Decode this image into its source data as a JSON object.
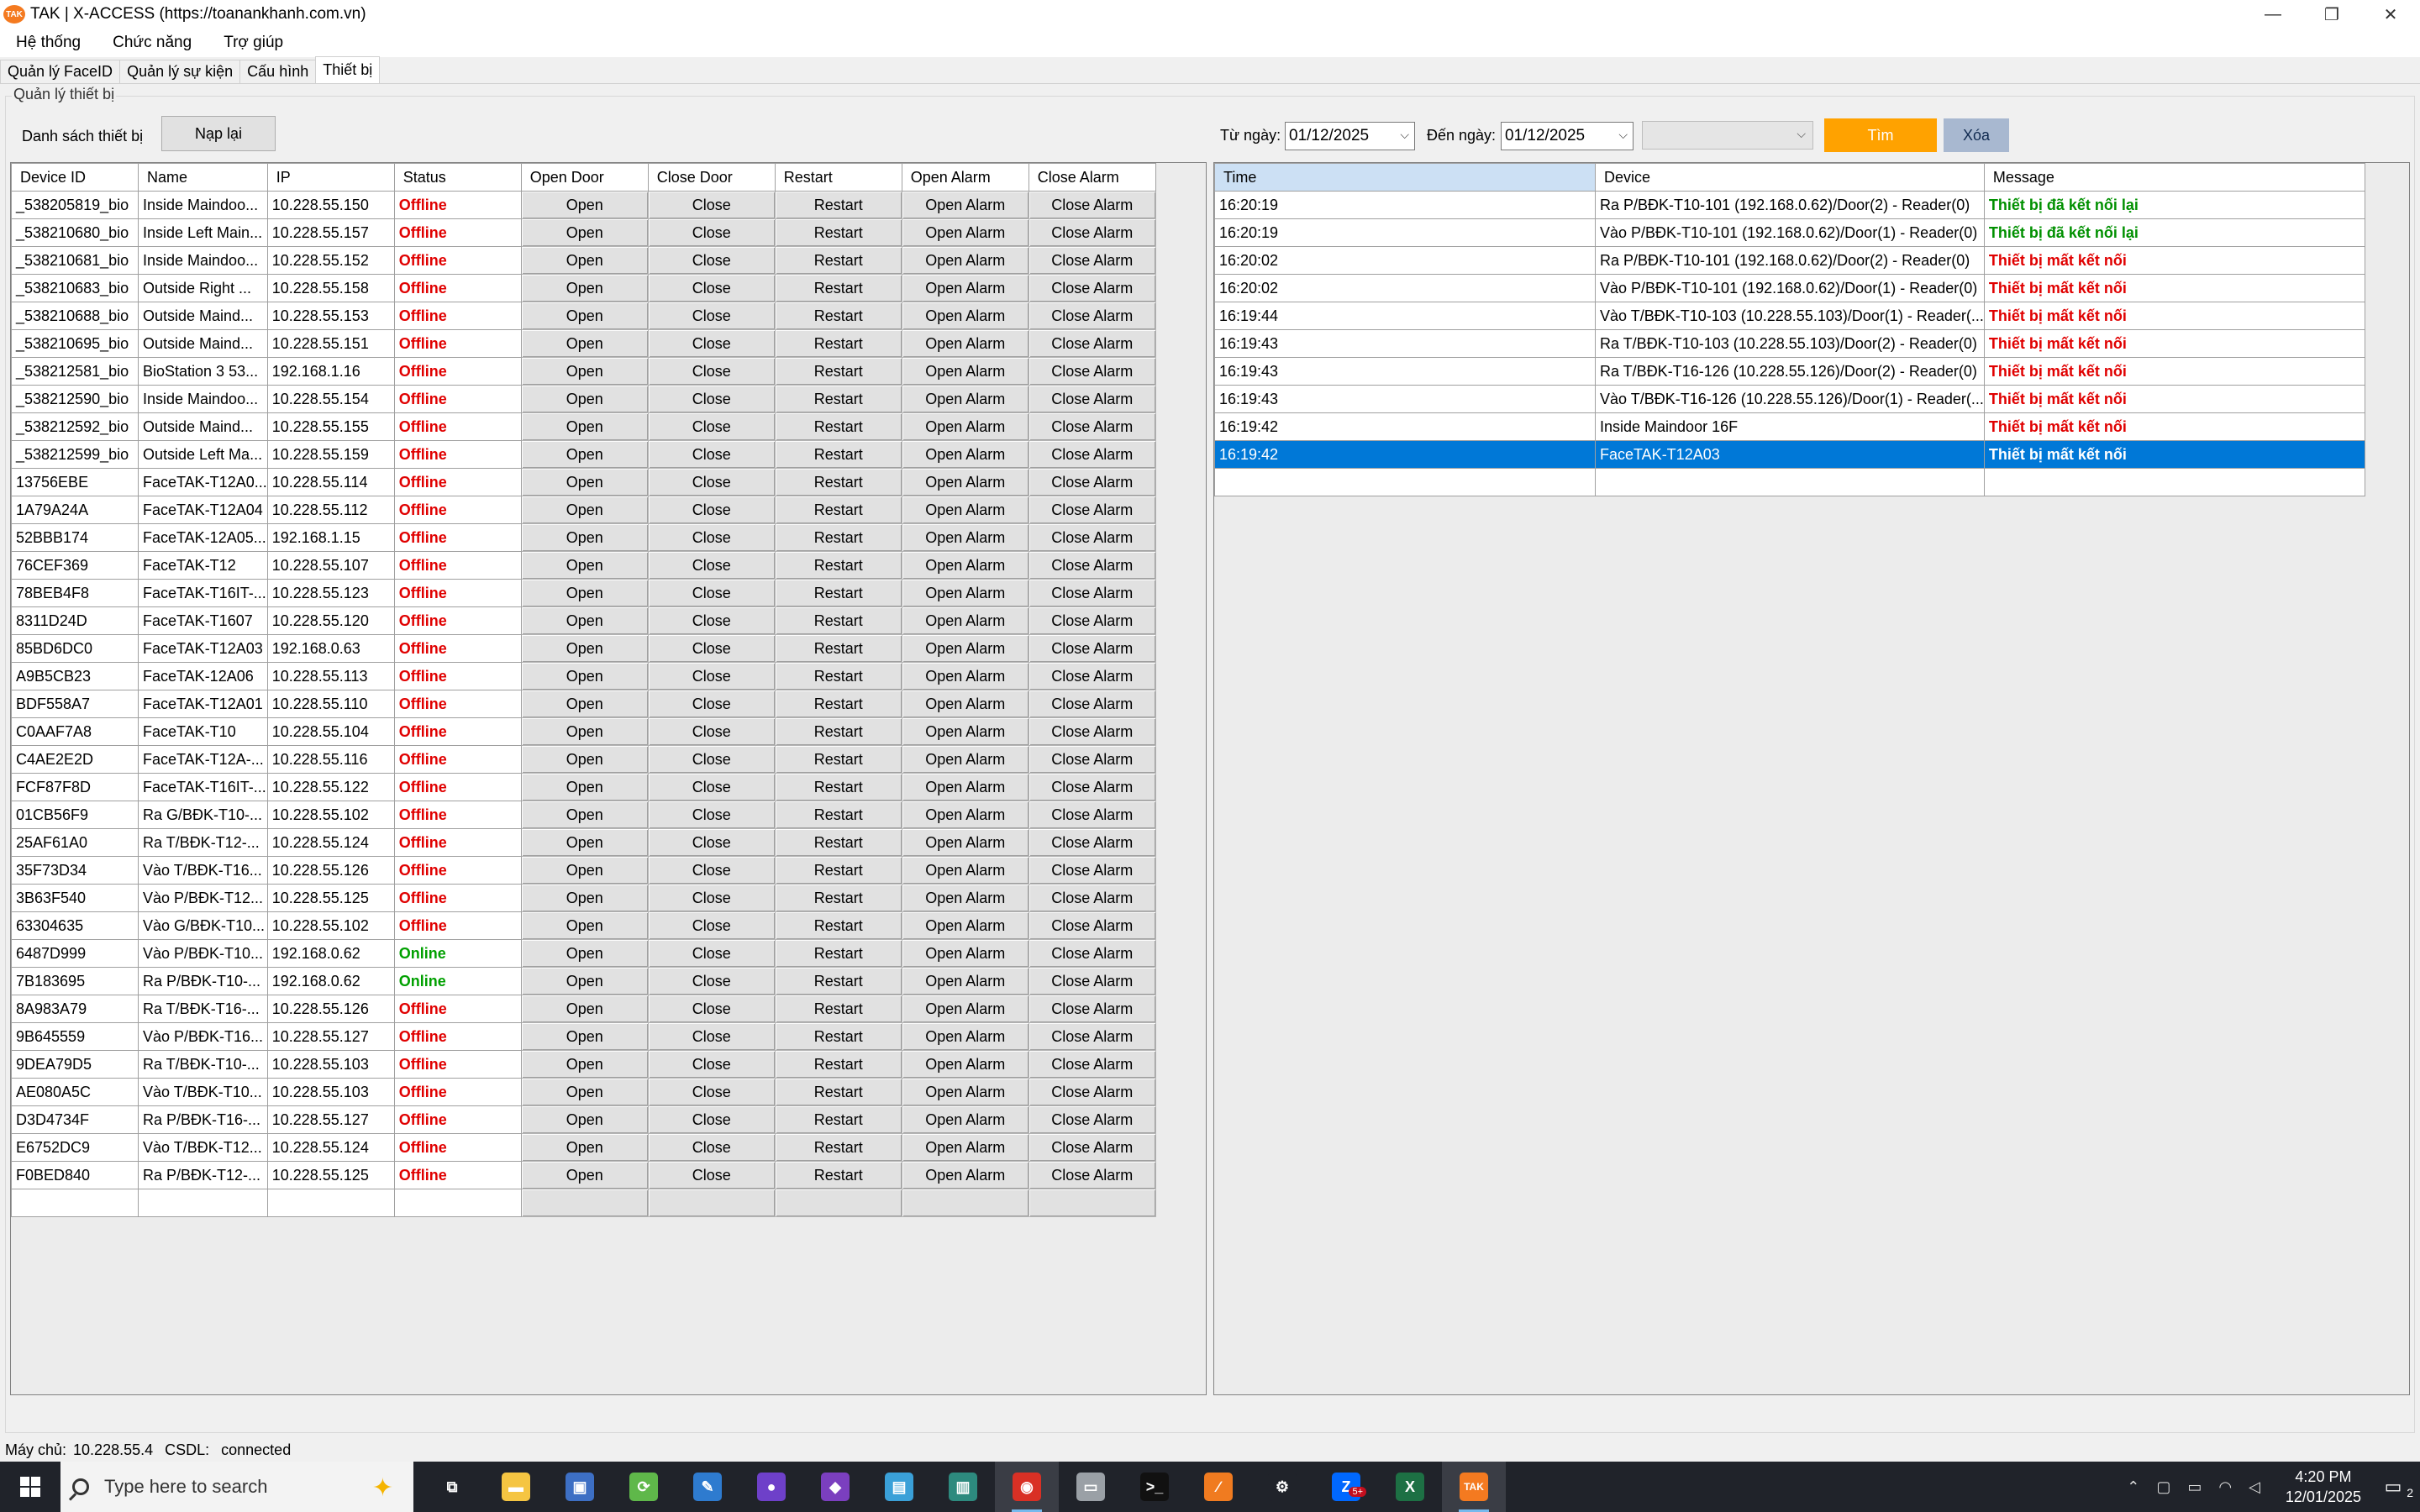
{
  "window": {
    "title": "TAK | X-ACCESS (https://toanankhanh.com.vn)",
    "logo_text": "TAK",
    "minimize": "—",
    "restore": "❐",
    "close": "✕"
  },
  "menu": [
    "Hệ thống",
    "Chức năng",
    "Trợ giúp"
  ],
  "tabs": [
    "Quản lý FaceID",
    "Quản lý sự kiện",
    "Cấu hình",
    "Thiết bị"
  ],
  "group_title": "Quản lý thiết bị",
  "device_list_label": "Danh sách thiết bị",
  "reload_button": "Nạp lại",
  "filter": {
    "from_label": "Từ ngày:",
    "from_value": "01/12/2025",
    "to_label": "Đến ngày:",
    "to_value": "01/12/2025",
    "find_button": "Tìm",
    "clear_button": "Xóa"
  },
  "device_columns": [
    "Device ID",
    "Name",
    "IP",
    "Status",
    "Open Door",
    "Close Door",
    "Restart",
    "Open Alarm",
    "Close Alarm"
  ],
  "device_button_labels": {
    "open": "Open",
    "close": "Close",
    "restart": "Restart",
    "open_alarm": "Open Alarm",
    "close_alarm": "Close Alarm"
  },
  "devices": [
    {
      "id": "_538205819_bio",
      "name": "Inside Maindoo...",
      "ip": "10.228.55.150",
      "status": "Offline"
    },
    {
      "id": "_538210680_bio",
      "name": "Inside Left Main...",
      "ip": "10.228.55.157",
      "status": "Offline"
    },
    {
      "id": "_538210681_bio",
      "name": "Inside Maindoo...",
      "ip": "10.228.55.152",
      "status": "Offline"
    },
    {
      "id": "_538210683_bio",
      "name": "Outside Right ...",
      "ip": "10.228.55.158",
      "status": "Offline"
    },
    {
      "id": "_538210688_bio",
      "name": "Outside Maind...",
      "ip": "10.228.55.153",
      "status": "Offline"
    },
    {
      "id": "_538210695_bio",
      "name": "Outside Maind...",
      "ip": "10.228.55.151",
      "status": "Offline"
    },
    {
      "id": "_538212581_bio",
      "name": "BioStation 3 53...",
      "ip": "192.168.1.16",
      "status": "Offline"
    },
    {
      "id": "_538212590_bio",
      "name": "Inside Maindoo...",
      "ip": "10.228.55.154",
      "status": "Offline"
    },
    {
      "id": "_538212592_bio",
      "name": "Outside Maind...",
      "ip": "10.228.55.155",
      "status": "Offline"
    },
    {
      "id": "_538212599_bio",
      "name": "Outside Left Ma...",
      "ip": "10.228.55.159",
      "status": "Offline"
    },
    {
      "id": "13756EBE",
      "name": "FaceTAK-T12A0...",
      "ip": "10.228.55.114",
      "status": "Offline"
    },
    {
      "id": "1A79A24A",
      "name": "FaceTAK-T12A04",
      "ip": "10.228.55.112",
      "status": "Offline"
    },
    {
      "id": "52BBB174",
      "name": "FaceTAK-12A05...",
      "ip": "192.168.1.15",
      "status": "Offline"
    },
    {
      "id": "76CEF369",
      "name": "FaceTAK-T12",
      "ip": "10.228.55.107",
      "status": "Offline"
    },
    {
      "id": "78BEB4F8",
      "name": "FaceTAK-T16IT-...",
      "ip": "10.228.55.123",
      "status": "Offline"
    },
    {
      "id": "8311D24D",
      "name": "FaceTAK-T1607",
      "ip": "10.228.55.120",
      "status": "Offline"
    },
    {
      "id": "85BD6DC0",
      "name": "FaceTAK-T12A03",
      "ip": "192.168.0.63",
      "status": "Offline"
    },
    {
      "id": "A9B5CB23",
      "name": "FaceTAK-12A06",
      "ip": "10.228.55.113",
      "status": "Offline"
    },
    {
      "id": "BDF558A7",
      "name": "FaceTAK-T12A01",
      "ip": "10.228.55.110",
      "status": "Offline"
    },
    {
      "id": "C0AAF7A8",
      "name": "FaceTAK-T10",
      "ip": "10.228.55.104",
      "status": "Offline"
    },
    {
      "id": "C4AE2E2D",
      "name": "FaceTAK-T12A-...",
      "ip": "10.228.55.116",
      "status": "Offline"
    },
    {
      "id": "FCF87F8D",
      "name": "FaceTAK-T16IT-...",
      "ip": "10.228.55.122",
      "status": "Offline"
    },
    {
      "id": "01CB56F9",
      "name": "Ra G/BĐK-T10-...",
      "ip": "10.228.55.102",
      "status": "Offline"
    },
    {
      "id": "25AF61A0",
      "name": "Ra T/BĐK-T12-...",
      "ip": "10.228.55.124",
      "status": "Offline"
    },
    {
      "id": "35F73D34",
      "name": "Vào T/BĐK-T16...",
      "ip": "10.228.55.126",
      "status": "Offline"
    },
    {
      "id": "3B63F540",
      "name": "Vào P/BĐK-T12...",
      "ip": "10.228.55.125",
      "status": "Offline"
    },
    {
      "id": "63304635",
      "name": "Vào G/BĐK-T10...",
      "ip": "10.228.55.102",
      "status": "Offline"
    },
    {
      "id": "6487D999",
      "name": "Vào P/BĐK-T10...",
      "ip": "192.168.0.62",
      "status": "Online"
    },
    {
      "id": "7B183695",
      "name": "Ra P/BĐK-T10-...",
      "ip": "192.168.0.62",
      "status": "Online"
    },
    {
      "id": "8A983A79",
      "name": "Ra T/BĐK-T16-...",
      "ip": "10.228.55.126",
      "status": "Offline"
    },
    {
      "id": "9B645559",
      "name": "Vào P/BĐK-T16...",
      "ip": "10.228.55.127",
      "status": "Offline"
    },
    {
      "id": "9DEA79D5",
      "name": "Ra T/BĐK-T10-...",
      "ip": "10.228.55.103",
      "status": "Offline"
    },
    {
      "id": "AE080A5C",
      "name": "Vào T/BĐK-T10...",
      "ip": "10.228.55.103",
      "status": "Offline"
    },
    {
      "id": "D3D4734F",
      "name": "Ra P/BĐK-T16-...",
      "ip": "10.228.55.127",
      "status": "Offline"
    },
    {
      "id": "E6752DC9",
      "name": "Vào T/BĐK-T12...",
      "ip": "10.228.55.124",
      "status": "Offline"
    },
    {
      "id": "F0BED840",
      "name": "Ra P/BĐK-T12-...",
      "ip": "10.228.55.125",
      "status": "Offline"
    }
  ],
  "event_columns": [
    "Time",
    "Device",
    "Message"
  ],
  "events": [
    {
      "time": "16:20:19",
      "device": "Ra P/BĐK-T10-101 (192.168.0.62)/Door(2) - Reader(0)",
      "message": "Thiết bị đã kết nối lại",
      "kind": "ok"
    },
    {
      "time": "16:20:19",
      "device": "Vào P/BĐK-T10-101 (192.168.0.62)/Door(1) - Reader(0)",
      "message": "Thiết bị đã kết nối lại",
      "kind": "ok"
    },
    {
      "time": "16:20:02",
      "device": "Ra P/BĐK-T10-101 (192.168.0.62)/Door(2) - Reader(0)",
      "message": "Thiết bị mất kết nối",
      "kind": "bad"
    },
    {
      "time": "16:20:02",
      "device": "Vào P/BĐK-T10-101 (192.168.0.62)/Door(1) - Reader(0)",
      "message": "Thiết bị mất kết nối",
      "kind": "bad"
    },
    {
      "time": "16:19:44",
      "device": "Vào T/BĐK-T10-103 (10.228.55.103)/Door(1) - Reader(...",
      "message": "Thiết bị mất kết nối",
      "kind": "bad"
    },
    {
      "time": "16:19:43",
      "device": "Ra T/BĐK-T10-103 (10.228.55.103)/Door(2) - Reader(0)",
      "message": "Thiết bị mất kết nối",
      "kind": "bad"
    },
    {
      "time": "16:19:43",
      "device": "Ra T/BĐK-T16-126 (10.228.55.126)/Door(2) - Reader(0)",
      "message": "Thiết bị mất kết nối",
      "kind": "bad"
    },
    {
      "time": "16:19:43",
      "device": "Vào T/BĐK-T16-126 (10.228.55.126)/Door(1) - Reader(...",
      "message": "Thiết bị mất kết nối",
      "kind": "bad"
    },
    {
      "time": "16:19:42",
      "device": "Inside Maindoor 16F",
      "message": "Thiết bị mất kết nối",
      "kind": "bad"
    },
    {
      "time": "16:19:42",
      "device": "FaceTAK-T12A03",
      "message": "Thiết bị mất kết nối",
      "kind": "bad",
      "selected": true
    }
  ],
  "statusbar": {
    "server_label": "Máy chủ:",
    "server_value": "10.228.55.4",
    "db_label": "CSDL:",
    "db_value": "connected"
  },
  "taskbar": {
    "search_placeholder": "Type here to search",
    "apps": [
      {
        "icon": "task-view-icon",
        "color": "#20232a",
        "glyph": "⧉"
      },
      {
        "icon": "file-explorer-icon",
        "color": "#f5c542",
        "glyph": "▬"
      },
      {
        "icon": "remote-desktop-icon",
        "color": "#3d6fc4",
        "glyph": "▣"
      },
      {
        "icon": "git-client-icon",
        "color": "#5fb84a",
        "glyph": "⟳"
      },
      {
        "icon": "notes-app-icon",
        "color": "#2e7bcf",
        "glyph": "✎"
      },
      {
        "icon": "github-icon",
        "color": "#6e40c9",
        "glyph": "●"
      },
      {
        "icon": "visual-studio-icon",
        "color": "#7b3fbf",
        "glyph": "◆"
      },
      {
        "icon": "notepad-icon",
        "color": "#3aa0d8",
        "glyph": "▤"
      },
      {
        "icon": "database-tool-icon",
        "color": "#2d8a7e",
        "glyph": "▥"
      },
      {
        "icon": "chrome-icon",
        "color": "#d93025",
        "glyph": "◉",
        "active": true
      },
      {
        "icon": "printer-icon",
        "color": "#9aa0a6",
        "glyph": "▭"
      },
      {
        "icon": "terminal-icon",
        "color": "#111111",
        "glyph": ">_"
      },
      {
        "icon": "sublime-icon",
        "color": "#f07b20",
        "glyph": "∕"
      },
      {
        "icon": "settings-icon",
        "color": "#20232a",
        "glyph": "⚙"
      },
      {
        "icon": "zalo-icon",
        "color": "#0068ff",
        "glyph": "Z",
        "badge": "5+"
      },
      {
        "icon": "excel-icon",
        "color": "#1d7044",
        "glyph": "X"
      },
      {
        "icon": "tak-app-icon",
        "color": "#f47a20",
        "glyph": "TAK",
        "active": true
      }
    ],
    "time": "4:20 PM",
    "date": "12/01/2025",
    "notification_count": "2"
  }
}
